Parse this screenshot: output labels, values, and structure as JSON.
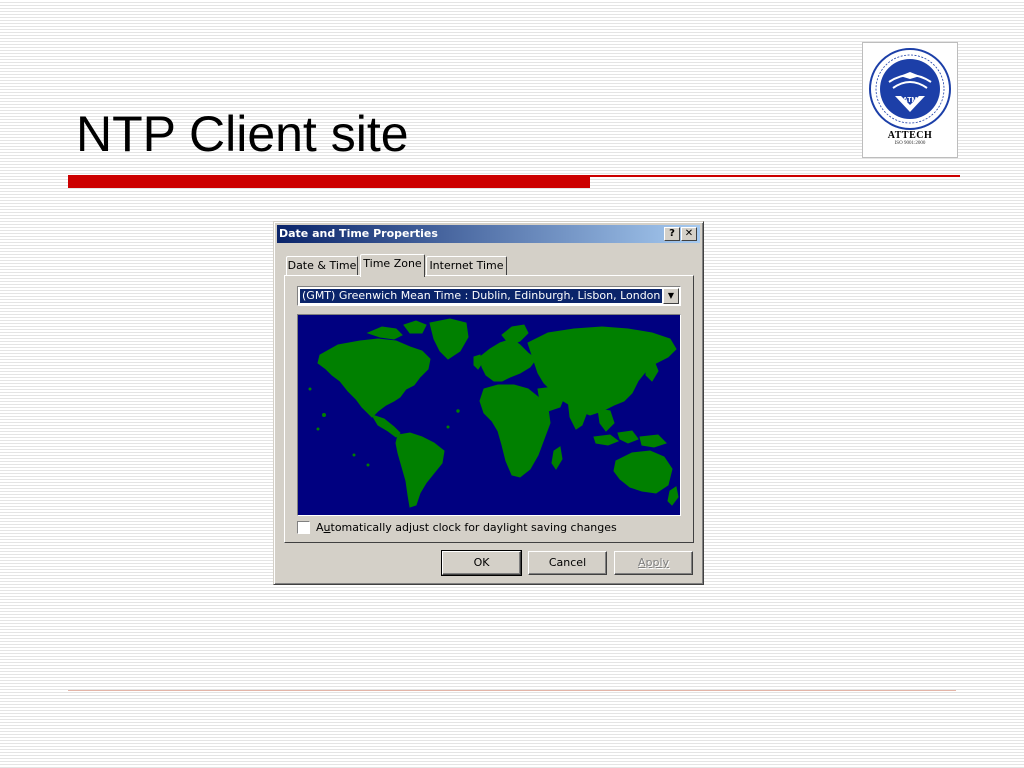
{
  "slide": {
    "title": "NTP Client site"
  },
  "logo": {
    "brand": "ATTECH",
    "iso": "ISO 9001:2000",
    "ring_text": "TRUNG TÂM QUẢN LÝ BAY DÂN DỤNG VIỆT NAM · VIETNAM AIR TRAFFIC MANAGEMENT",
    "mark": "ATM"
  },
  "dialog": {
    "title": "Date and Time Properties",
    "help_label": "?",
    "close_label": "✕",
    "tabs": [
      {
        "label": "Date & Time",
        "active": false
      },
      {
        "label": "Time Zone",
        "active": true
      },
      {
        "label": "Internet Time",
        "active": false
      }
    ],
    "timezone": {
      "selected": "(GMT) Greenwich Mean Time : Dublin, Edinburgh, Lisbon, London",
      "arrow_icon": "chevron-down-icon"
    },
    "map": {
      "ocean_color": "#000080",
      "land_color": "#008000"
    },
    "dst": {
      "checked": false,
      "label_before": "A",
      "label_underlined": "u",
      "label_after": "tomatically adjust clock for daylight saving changes"
    },
    "buttons": {
      "ok": "OK",
      "cancel": "Cancel",
      "apply": "Apply"
    }
  },
  "colors": {
    "accent": "#cc0000",
    "titlebar_start": "#0a246a",
    "titlebar_end": "#a6caf0",
    "dialog_face": "#d4d0c8"
  }
}
